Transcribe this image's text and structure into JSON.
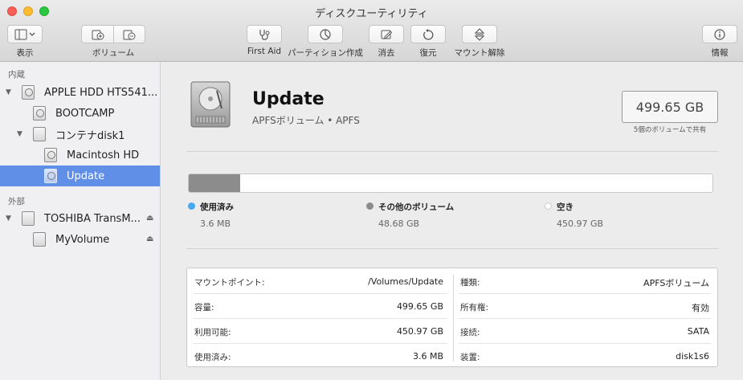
{
  "window": {
    "title": "ディスクユーティリティ"
  },
  "toolbar": {
    "view_label": "表示",
    "volume_label": "ボリューム",
    "firstaid_label": "First Aid",
    "partition_label": "パーティション作成",
    "erase_label": "消去",
    "restore_label": "復元",
    "unmount_label": "マウント解除",
    "info_label": "情報"
  },
  "sidebar": {
    "internal_title": "内蔵",
    "external_title": "外部",
    "items": [
      {
        "label": "APPLE HDD HTS541..."
      },
      {
        "label": "BOOTCAMP"
      },
      {
        "label": "コンテナdisk1"
      },
      {
        "label": "Macintosh HD"
      },
      {
        "label": "Update"
      },
      {
        "label": "TOSHIBA TransM..."
      },
      {
        "label": "MyVolume"
      }
    ],
    "selected": "Update"
  },
  "volume": {
    "name": "Update",
    "subtitle": "APFSボリューム • APFS",
    "capacity": "499.65 GB",
    "capacity_note": "5個のボリュームで共有"
  },
  "usage": {
    "used_fraction": 7.2e-06,
    "other_fraction": 0.0974,
    "legend": [
      {
        "name": "使用済み",
        "value": "3.6 MB",
        "color": "#4aa8ef"
      },
      {
        "name": "その他のボリューム",
        "value": "48.68 GB",
        "color": "#8c8c8c"
      },
      {
        "name": "空き",
        "value": "450.97 GB",
        "color": "#ffffff"
      }
    ]
  },
  "details": {
    "left": [
      {
        "key": "マウントポイント:",
        "value": "/Volumes/Update"
      },
      {
        "key": "容量:",
        "value": "499.65 GB"
      },
      {
        "key": "利用可能:",
        "value": "450.97 GB"
      },
      {
        "key": "使用済み:",
        "value": "3.6 MB"
      }
    ],
    "right": [
      {
        "key": "種類:",
        "value": "APFSボリューム"
      },
      {
        "key": "所有権:",
        "value": "有効"
      },
      {
        "key": "接続:",
        "value": "SATA"
      },
      {
        "key": "装置:",
        "value": "disk1s6"
      }
    ]
  }
}
